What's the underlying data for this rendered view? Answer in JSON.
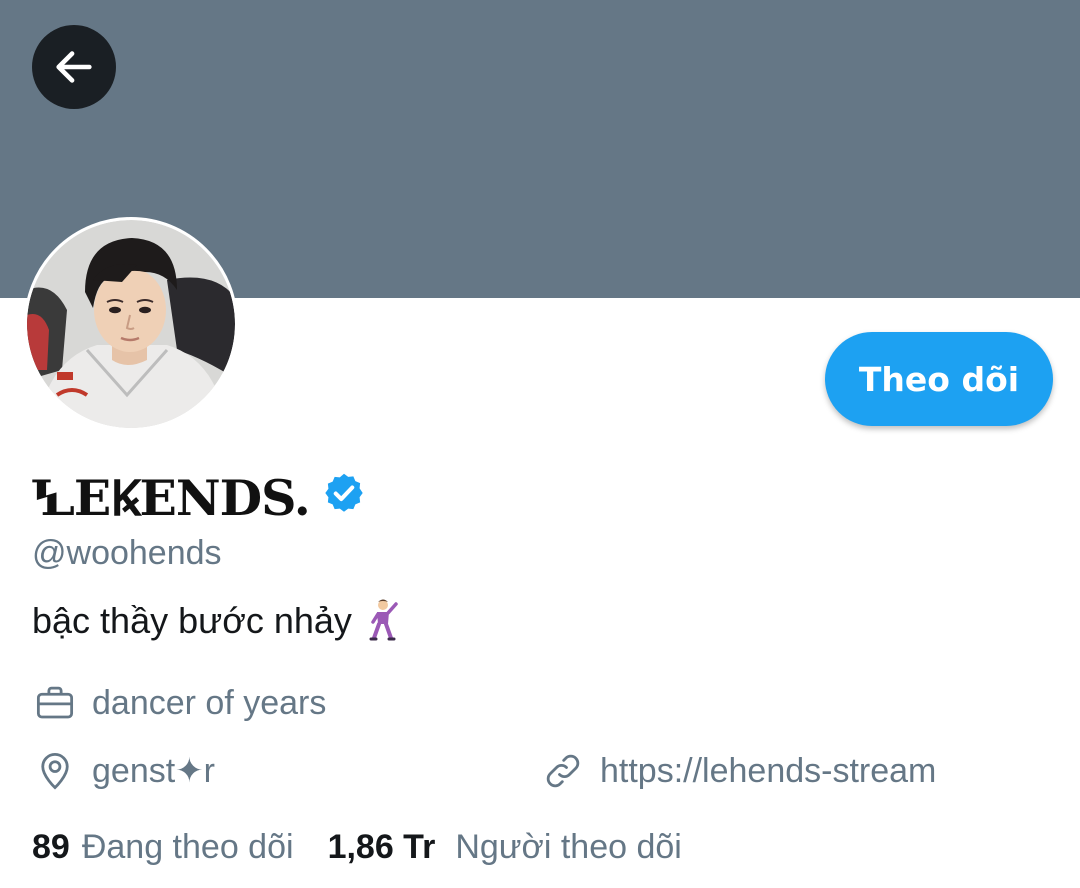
{
  "header": {
    "back_icon": "arrow-left-icon",
    "banner_color": "#657786"
  },
  "profile": {
    "display_name": "ꝆEꝂENDS.",
    "verified_icon": "verified-badge-icon",
    "handle": "@woohends",
    "bio_text": "bậc thầy bước nhảy",
    "bio_emoji_icon": "dancer-emoji-icon",
    "follow_label": "Theo dõi",
    "accent_color": "#1da1f2"
  },
  "meta": {
    "profession": {
      "icon": "briefcase-icon",
      "text": "dancer of years"
    },
    "location": {
      "icon": "location-pin-icon",
      "text": "genst✦r"
    },
    "website": {
      "icon": "link-icon",
      "text": "https://lehends-stream"
    }
  },
  "stats": {
    "following_count": "89",
    "following_label": "Đang theo dõi",
    "followers_count": "1,86 Tr",
    "followers_label": "Người theo dõi"
  }
}
